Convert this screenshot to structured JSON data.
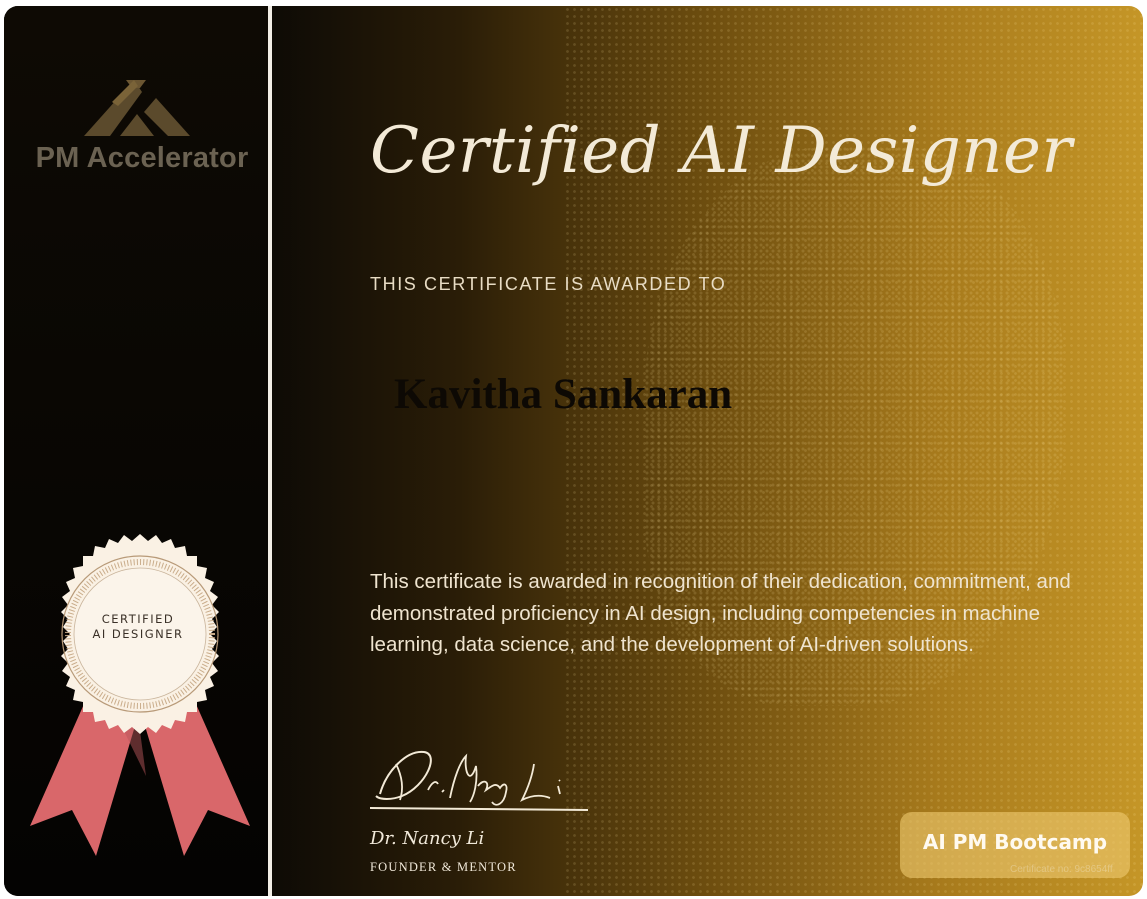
{
  "brand": {
    "logo_text": "PM Accelerator",
    "logo_color": "#6b6252"
  },
  "seal": {
    "line1": "CERTIFIED",
    "line2": "AI DESIGNER",
    "ribbon_color": "#d9676a",
    "seal_color": "#faf1e4"
  },
  "certificate": {
    "title": "Certified AI Designer",
    "awarded_to_label": "THIS CERTIFICATE IS AWARDED TO",
    "recipient_name": "Kavitha Sankaran",
    "description": "This certificate is awarded in recognition of their dedication, commitment, and demonstrated proficiency in AI design, including competencies in machine learning, data science, and the development of AI-driven solutions."
  },
  "signatory": {
    "signature_text": "Dr.Nancy Li",
    "name": "Dr. Nancy Li",
    "role": "FOUNDER & MENTOR"
  },
  "program_badge": {
    "label": "AI PM Bootcamp",
    "certificate_id": "Certificate no: 9c8654ff"
  },
  "colors": {
    "gold_accent": "#c59627",
    "dark_panel": "#050403",
    "divider": "#f2eee6"
  }
}
